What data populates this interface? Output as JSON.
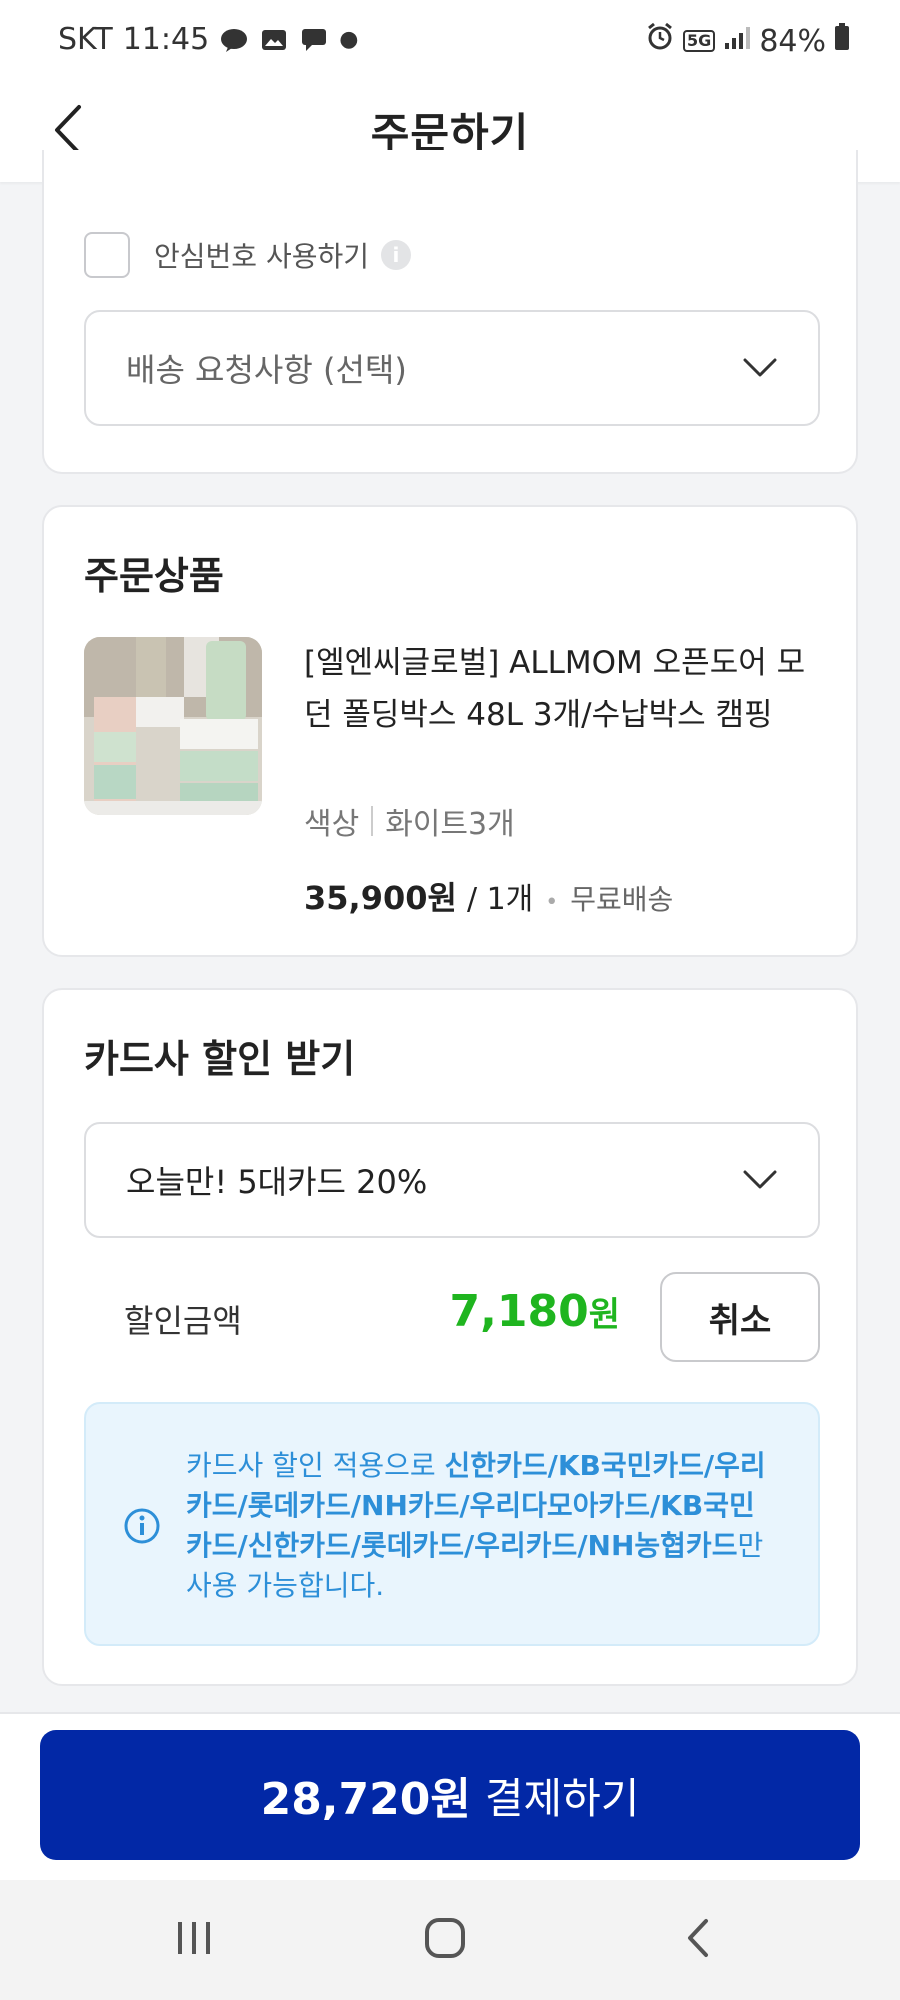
{
  "status_bar": {
    "carrier": "SKT",
    "time": "11:45",
    "network": "5G",
    "battery": "84%"
  },
  "header": {
    "title": "주문하기"
  },
  "delivery": {
    "safe_number_label": "안심번호 사용하기",
    "request_placeholder": "배송 요청사항 (선택)"
  },
  "order_items": {
    "title": "주문상품",
    "items": [
      {
        "name": "[엘엔씨글로벌] ALLMOM 오픈도어 모던 폴딩박스 48L 3개/수납박스 캠핑",
        "option_label": "색상",
        "option_value": "화이트3개",
        "price": "35,900원",
        "quantity": "/ 1개",
        "shipping": "무료배송"
      }
    ]
  },
  "card_discount": {
    "title": "카드사 할인 받기",
    "selected_option": "오늘만! 5대카드 20%",
    "amount_label": "할인금액",
    "amount_value": "7,180",
    "amount_unit": "원",
    "cancel_label": "취소",
    "notice_prefix": "카드사 할인 적용으로 ",
    "notice_cards": "신한카드/KB국민카드/우리카드/롯데카드/NH카드/우리다모아카드/KB국민카드/신한카드/롯데카드/우리카드/NH농협카드",
    "notice_suffix": "만 사용 가능합니다.",
    "amount_color": "#1fb51f",
    "notice_color": "#2d8fd8"
  },
  "payment": {
    "total": "28,720원",
    "action_label": "결제하기",
    "button_color": "#0228a6"
  },
  "icons": {
    "back": "chevron-left-icon",
    "dropdown": "chevron-down-icon",
    "info": "info-icon"
  }
}
